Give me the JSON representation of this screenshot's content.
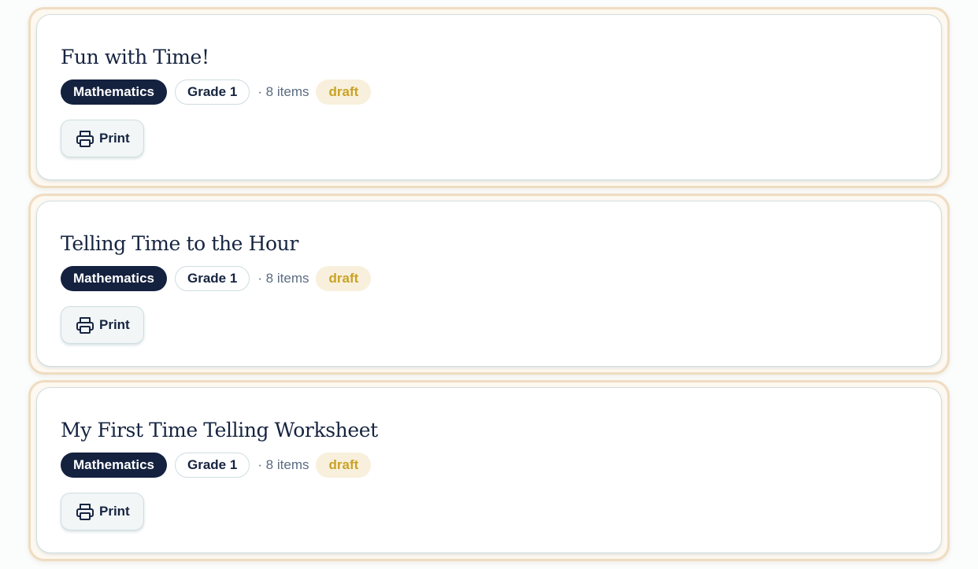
{
  "worksheets": [
    {
      "title": "Fun with Time!",
      "subject": "Mathematics",
      "grade": "Grade 1",
      "items": "· 8 items",
      "status": "draft",
      "print_label": "Print"
    },
    {
      "title": "Telling Time to the Hour",
      "subject": "Mathematics",
      "grade": "Grade 1",
      "items": "· 8 items",
      "status": "draft",
      "print_label": "Print"
    },
    {
      "title": "My First Time Telling Worksheet",
      "subject": "Mathematics",
      "grade": "Grade 1",
      "items": "· 8 items",
      "status": "draft",
      "print_label": "Print"
    }
  ],
  "icons": {
    "print": "printer-icon"
  },
  "colors": {
    "subject_pill": "#14213f",
    "status_text": "#c9a227",
    "status_bg": "#f8f0dc",
    "card_outline": "#efdcc0"
  }
}
